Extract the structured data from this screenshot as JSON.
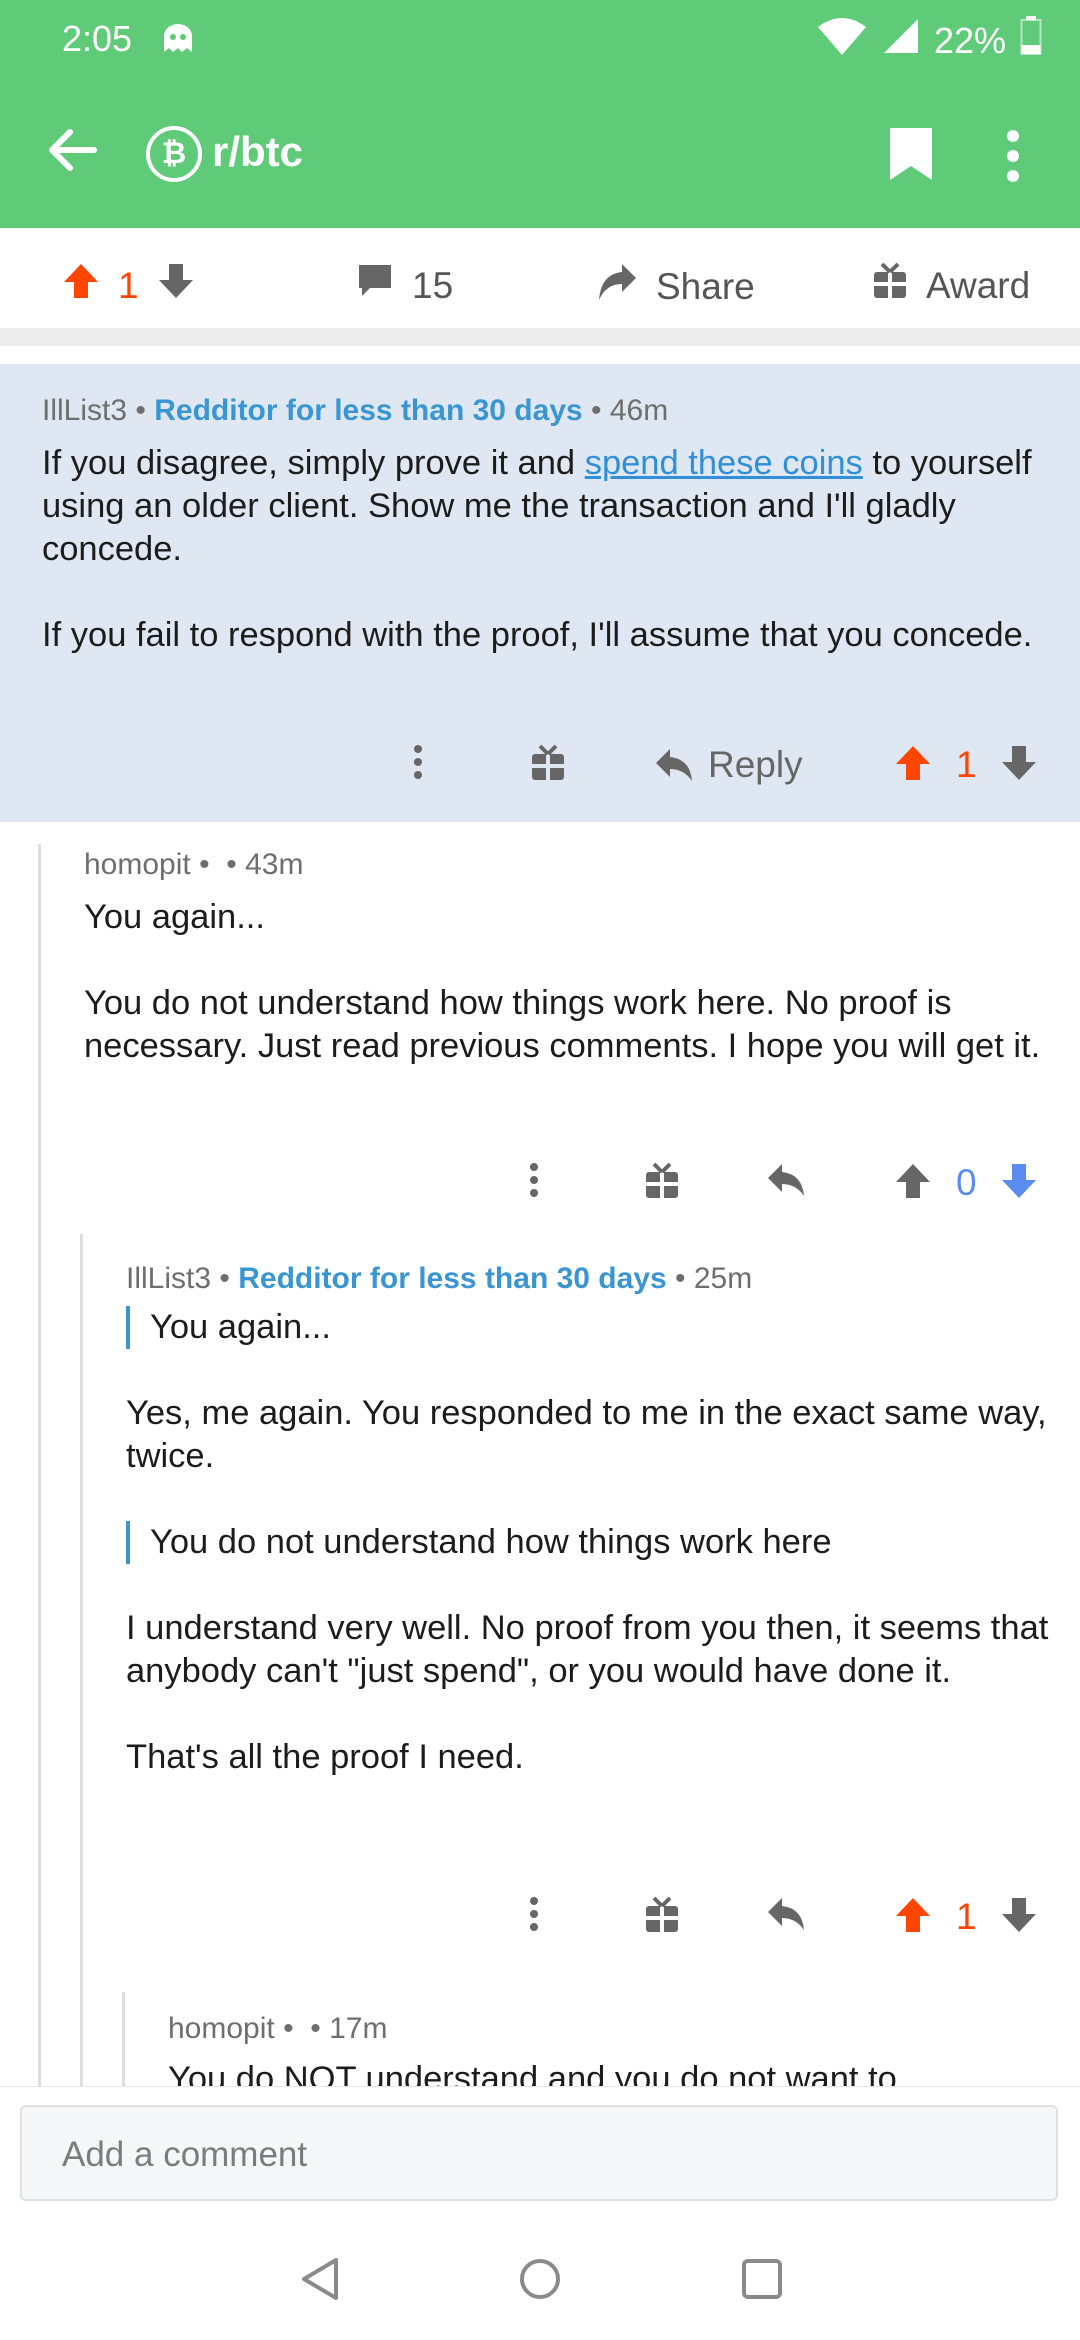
{
  "status": {
    "time": "2:05",
    "battery": "22%"
  },
  "header": {
    "subreddit": "r/btc",
    "logo_symbol": "₿"
  },
  "post_actions": {
    "score": "1",
    "comments": "15",
    "share": "Share",
    "award": "Award"
  },
  "comments": [
    {
      "author": "IllList3",
      "flair": "Redditor for less than 30 days",
      "age": "46m",
      "body_pre": "If you disagree, simply prove it and ",
      "link": "spend these coins",
      "body_post": " to yourself using an older client.  Show me the transaction and I'll gladly concede.",
      "para2": "If you fail to respond with the proof, I'll assume that you concede.",
      "reply": "Reply",
      "score": "1"
    },
    {
      "author": "homopit",
      "age": "43m",
      "para1": "You again...",
      "para2": "You do not understand how things work here. No proof is necessary. Just read previous comments. I hope you will get it.",
      "score": "0"
    },
    {
      "author": "IllList3",
      "flair": "Redditor for less than 30 days",
      "age": "25m",
      "quote1": "You again...",
      "para1": "Yes, me again.  You responded to me in the exact same way, twice.",
      "quote2": "You do not understand how things work here",
      "para2": "I understand very well.  No proof from you then, it seems that anybody can't \"just spend\", or you would have done it.",
      "para3": "That's all the proof I need.",
      "score": "1"
    },
    {
      "author": "homopit",
      "age": "17m",
      "para1": "You do NOT understand and you do not want to"
    }
  ],
  "composer": {
    "placeholder": "Add a comment"
  },
  "colors": {
    "header": "#5fcb79",
    "upvote": "#ff4500",
    "downvote": "#5b8df0",
    "flair": "#3a95d3",
    "op_highlight": "#dfe8f2"
  },
  "icons": [
    "ghost-icon",
    "wifi-icon",
    "signal-icon",
    "battery-icon",
    "back-arrow-icon",
    "bookmark-icon",
    "more-vert-icon",
    "upvote-icon",
    "downvote-icon",
    "comment-icon",
    "share-icon",
    "gift-icon",
    "reply-icon",
    "nav-back-icon",
    "nav-home-icon",
    "nav-recents-icon"
  ]
}
